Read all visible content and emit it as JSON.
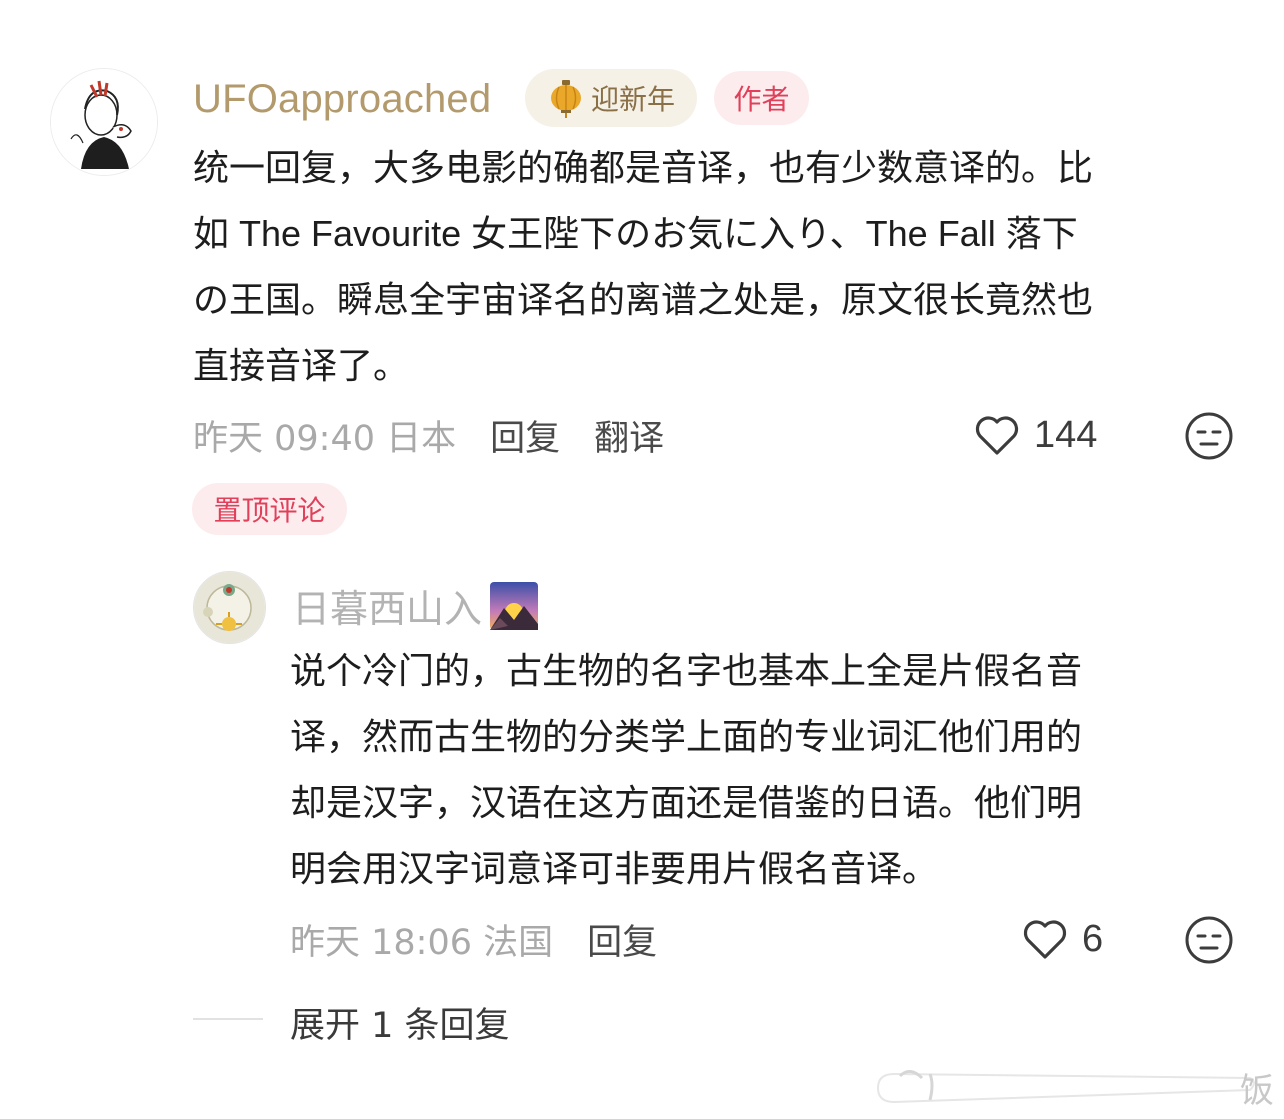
{
  "comment": {
    "username": "UFOapproached",
    "badge_festival": "迎新年",
    "badge_author": "作者",
    "lines": [
      "统一回复，大多电影的确都是音译，也有少数意译的。比",
      "如 The Favourite 女王陛下のお気に入り、The Fall 落下",
      "の王国。瞬息全宇宙译名的离谱之处是，原文很长竟然也",
      "直接音译了。"
    ],
    "time_location": "昨天 09:40 日本",
    "reply_label": "回复",
    "translate_label": "翻译",
    "like_count": "144",
    "pinned_label": "置顶评论"
  },
  "reply": {
    "username": "日暮西山入",
    "lines": [
      "说个冷门的，古生物的名字也基本上全是片假名音",
      "译，然而古生物的分类学上面的专业词汇他们用的",
      "却是汉字，汉语在这方面还是借鉴的日语。他们明",
      "明会用汉字词意译可非要用片假名音译。"
    ],
    "time_location": "昨天 18:06 法国",
    "reply_label": "回复",
    "like_count": "6",
    "expand_label": "展开 1 条回复"
  },
  "watermark": "饭",
  "icons": {
    "festival": "lantern-icon",
    "like": "heart-outline-icon",
    "reaction": "neutral-face-icon",
    "name_emoji": "sunrise-over-mountains-icon"
  },
  "colors": {
    "username": "#b39a6c",
    "author_badge": "#e0405a",
    "meta_gray": "#a9a9a9"
  }
}
